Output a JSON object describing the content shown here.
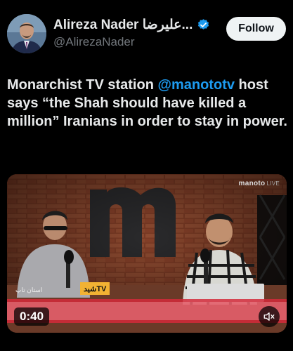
{
  "author": {
    "display_name": "Alireza Nader علیرضا...",
    "handle": "@AlirezaNader",
    "verified_icon": "verified-badge-icon",
    "avatar_icon": "profile-photo"
  },
  "follow_button": {
    "label": "Follow"
  },
  "tweet": {
    "text_before": "Monarchist TV station ",
    "mention": "@manototv",
    "text_after": " host says “the Shah should have killed a million” Iranians in order to stay in power."
  },
  "video": {
    "duration": "0:40",
    "channel_logo": "manoto",
    "channel_logo_suffix": "LIVE",
    "channel_tag": "شیدTV",
    "show_tag": "استان تاپ",
    "mute_icon": "speaker-muted-icon"
  },
  "colors": {
    "background": "#000000",
    "link": "#1d9bf0",
    "verified": "#1d9bf0",
    "follow_bg": "#eff3f4"
  }
}
